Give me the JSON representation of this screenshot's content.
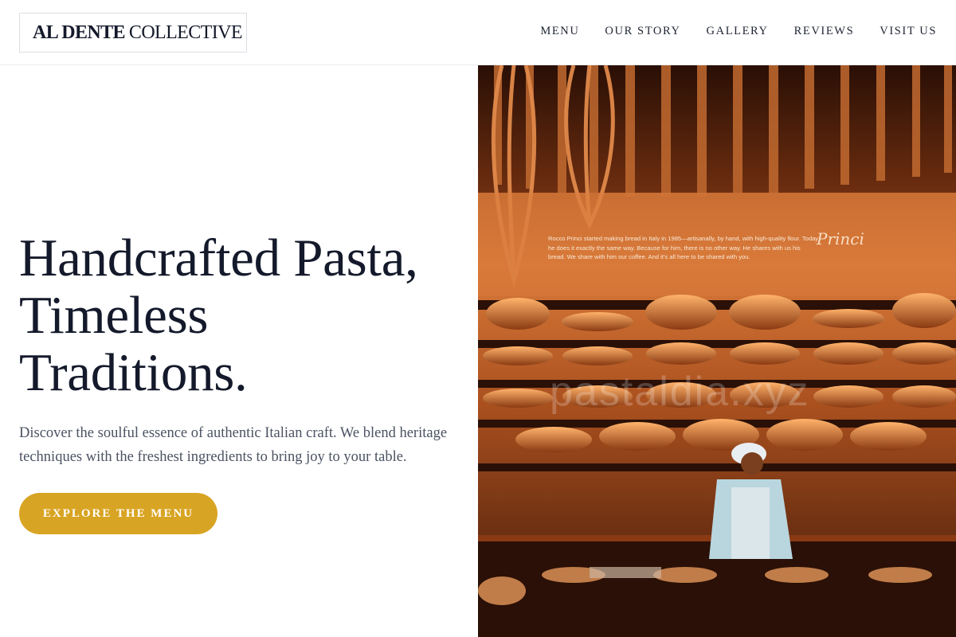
{
  "brand": {
    "name_bold": "AL DENTE",
    "name_light": "COLLECTIVE"
  },
  "nav": {
    "items": [
      {
        "label": "MENU"
      },
      {
        "label": "OUR STORY"
      },
      {
        "label": "GALLERY"
      },
      {
        "label": "REVIEWS"
      },
      {
        "label": "VISIT US"
      }
    ]
  },
  "hero": {
    "title_lines": [
      "Handcrafted Pasta,",
      "Timeless",
      "Traditions."
    ],
    "description": "Discover the soulful essence of authentic Italian craft. We blend heritage techniques with the freshest ingredients to bring joy to your table.",
    "cta_label": "EXPLORE THE MENU",
    "image": {
      "wall_text": "Rocco Princi started making bread in Italy in 1985—artisanally, by hand, with high-quality flour. Today he does it exactly the same way. Because for him, there is no other way. He shares with us his bread. We share with him our coffee. And it's all here to be shared with you.",
      "signature": "Princi",
      "watermark": "pastaldia.xyz"
    }
  },
  "colors": {
    "accent": "#d8a423",
    "heading": "#141a2b",
    "body_text": "#4b5262",
    "image_warm": "#c86a2c"
  }
}
